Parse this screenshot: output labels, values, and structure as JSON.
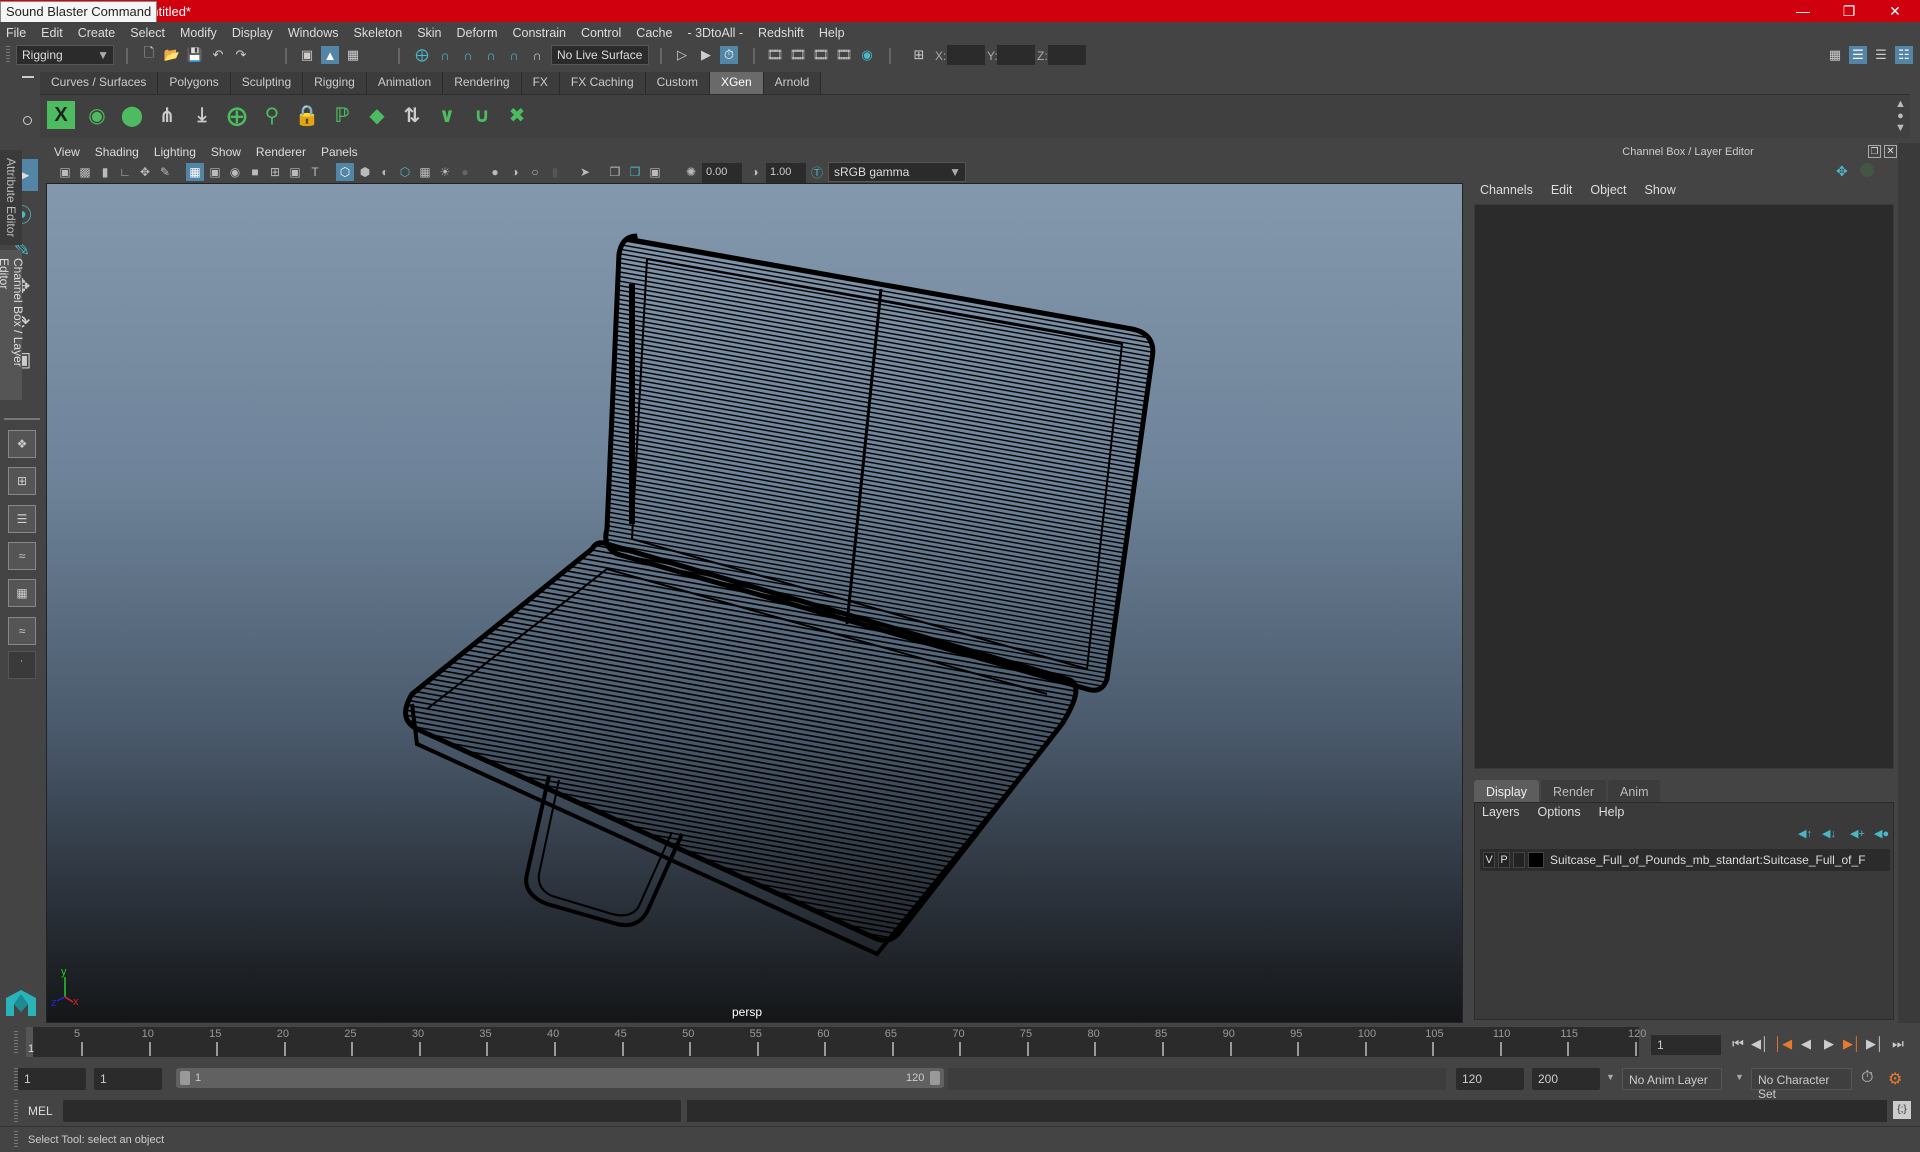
{
  "window": {
    "title": "untitled*",
    "tooltip": "Sound Blaster Command",
    "controls": [
      "minimize",
      "restore",
      "close"
    ]
  },
  "menubar": [
    "File",
    "Edit",
    "Create",
    "Select",
    "Modify",
    "Display",
    "Windows",
    "Skeleton",
    "Skin",
    "Deform",
    "Constrain",
    "Control",
    "Cache",
    "- 3DtoAll -",
    "Redshift",
    "Help"
  ],
  "toolbar": {
    "menuset": "Rigging",
    "live_surface": "No Live Surface",
    "coords": {
      "x_label": "X:",
      "y_label": "Y:",
      "z_label": "Z:",
      "x": "",
      "y": "",
      "z": ""
    }
  },
  "shelf": {
    "tabs": [
      "Curves / Surfaces",
      "Polygons",
      "Sculpting",
      "Rigging",
      "Animation",
      "Rendering",
      "FX",
      "FX Caching",
      "Custom",
      "XGen",
      "Arnold"
    ],
    "active_tab": "XGen",
    "icons": [
      "xgen-library-icon",
      "xgen-preview-icon",
      "xgen-clear-preview-icon",
      "add-guides-icon",
      "place-guides-icon",
      "add-guide-icon",
      "guide-visibility-icon",
      "guide-lock-icon",
      "sculpt-guides-icon",
      "interactive-groom-icon",
      "groom-modifier-icon",
      "groom-select-icon",
      "groom-collection-icon",
      "groom-delete-icon"
    ]
  },
  "viewport": {
    "menu": [
      "View",
      "Shading",
      "Lighting",
      "Show",
      "Renderer",
      "Panels"
    ],
    "exposure": "0.00",
    "gamma": "1.00",
    "color_space": "sRGB gamma",
    "camera": "persp",
    "axis": {
      "x": "x",
      "y": "y",
      "z": "z"
    },
    "wire_color": "#000000"
  },
  "right_panel": {
    "title": "Channel Box / Layer Editor",
    "channel_menu": [
      "Channels",
      "Edit",
      "Object",
      "Show"
    ],
    "layer_tabs": [
      "Display",
      "Render",
      "Anim"
    ],
    "active_layer_tab": "Display",
    "layer_menu": [
      "Layers",
      "Options",
      "Help"
    ],
    "layers": [
      {
        "v": "V",
        "p": "P",
        "name": "Suitcase_Full_of_Pounds_mb_standart:Suitcase_Full_of_F",
        "color": "#000000"
      }
    ],
    "side_tabs": [
      "Attribute Editor",
      "Channel Box / Layer Editor"
    ]
  },
  "timeline": {
    "start": 1,
    "end": 120,
    "ticks": [
      5,
      10,
      15,
      20,
      25,
      30,
      35,
      40,
      45,
      50,
      55,
      60,
      65,
      70,
      75,
      80,
      85,
      90,
      95,
      100,
      105,
      110,
      115,
      120
    ],
    "current_frame_label": "1",
    "current_frame_field": "1"
  },
  "range": {
    "start_field": "1",
    "playback_start": "1",
    "slider_start": "1",
    "slider_end": "120",
    "playback_end": "120",
    "anim_end": "200",
    "anim_layer": "No Anim Layer",
    "character_set": "No Character Set"
  },
  "command": {
    "label": "MEL",
    "input": "",
    "output": ""
  },
  "status": "Select Tool: select an object",
  "colors": {
    "titlebar": "#d0000e",
    "accent": "#5285a6",
    "xgen_green": "#4dbb5f",
    "tool_teal": "#4ab8c8",
    "playback_orange": "#e87a2e"
  }
}
